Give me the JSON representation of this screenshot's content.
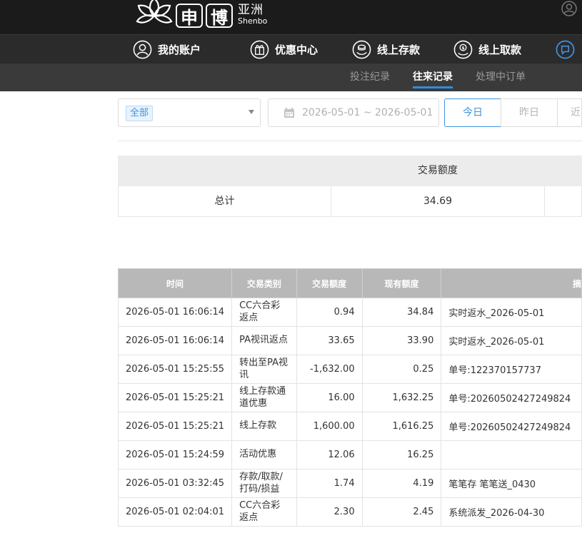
{
  "header": {
    "logo_char_1": "申",
    "logo_char_2": "博",
    "logo_cn": "亚洲",
    "logo_en": "Shenbo"
  },
  "main_nav": [
    {
      "label": "我的账户",
      "icon": "user-circle-icon"
    },
    {
      "label": "优惠中心",
      "icon": "gift-icon"
    },
    {
      "label": "线上存款",
      "icon": "deposit-icon"
    },
    {
      "label": "线上取款",
      "icon": "withdraw-icon"
    },
    {
      "label": "",
      "icon": "message-icon"
    }
  ],
  "sub_nav": [
    {
      "label": "投注纪录",
      "active": false
    },
    {
      "label": "往来记录",
      "active": true
    },
    {
      "label": "处理中订单",
      "active": false
    }
  ],
  "filters": {
    "type_tag": "全部",
    "date_range": "2026-05-01 ~ 2026-05-01",
    "range_buttons": [
      "今日",
      "昨日",
      "近"
    ]
  },
  "summary": {
    "header": "交易额度",
    "label": "总计",
    "value": "34.69"
  },
  "table": {
    "columns": [
      "时间",
      "交易类别",
      "交易额度",
      "现有额度",
      "摘"
    ],
    "rows": [
      {
        "time": "2026-05-01 16:06:14",
        "type": "CC六合彩返点",
        "amount": "0.94",
        "balance": "34.84",
        "remark": "实时返水_2026-05-01"
      },
      {
        "time": "2026-05-01 16:06:14",
        "type": "PA视讯返点",
        "amount": "33.65",
        "balance": "33.90",
        "remark": "实时返水_2026-05-01"
      },
      {
        "time": "2026-05-01 15:25:55",
        "type": "转出至PA视讯",
        "amount": "-1,632.00",
        "balance": "0.25",
        "remark": "单号:122370157737"
      },
      {
        "time": "2026-05-01 15:25:21",
        "type": "线上存款通道优惠",
        "amount": "16.00",
        "balance": "1,632.25",
        "remark": "单号:20260502427249824"
      },
      {
        "time": "2026-05-01 15:25:21",
        "type": "线上存款",
        "amount": "1,600.00",
        "balance": "1,616.25",
        "remark": "单号:20260502427249824"
      },
      {
        "time": "2026-05-01 15:24:59",
        "type": "活动优惠",
        "amount": "12.06",
        "balance": "16.25",
        "remark": ""
      },
      {
        "time": "2026-05-01 03:32:45",
        "type": "存款/取款/打码/损益",
        "amount": "1.74",
        "balance": "4.19",
        "remark": "笔笔存 笔笔送_0430"
      },
      {
        "time": "2026-05-01 02:04:01",
        "type": "CC六合彩返点",
        "amount": "2.30",
        "balance": "2.45",
        "remark": "系统派发_2026-04-30"
      }
    ]
  },
  "colors": {
    "accent": "#3f93dd",
    "header_bg": "#1b1b1b",
    "nav_bg": "#2b2b2b",
    "subnav_bg": "#3a3a3a",
    "table_header_bg": "#b8b8b8"
  }
}
